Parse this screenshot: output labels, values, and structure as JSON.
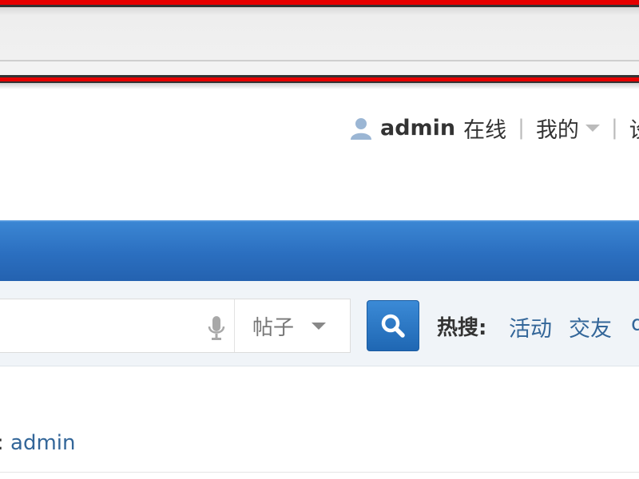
{
  "user_bar": {
    "username": "admin",
    "status": "在线",
    "separator": "|",
    "my_menu": "我的",
    "settings_partial": "设"
  },
  "search": {
    "scope": "帖子",
    "hot_label": "热搜:",
    "hot_links": [
      "活动",
      "交友",
      "d"
    ]
  },
  "info": {
    "prefix": ":",
    "author": "admin"
  },
  "colors": {
    "highlight_red": "#e60000",
    "nav_blue": "#2b6fc0",
    "link_blue": "#336699"
  }
}
